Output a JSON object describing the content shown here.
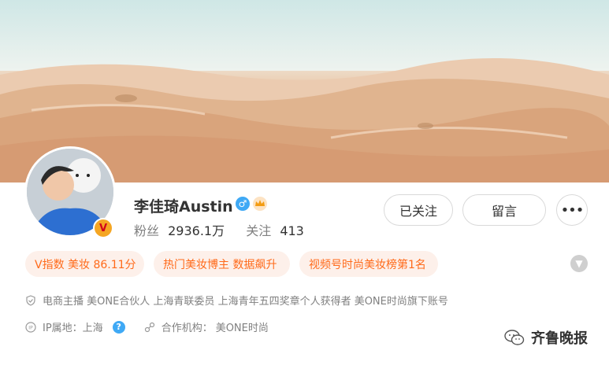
{
  "profile": {
    "name": "李佳琦Austin",
    "badge_letter": "V",
    "gender_icon": "male-icon",
    "vip_icon": "crown-icon",
    "followers_label": "粉丝",
    "followers_value": "2936.1万",
    "following_label": "关注",
    "following_value": "413"
  },
  "actions": {
    "follow_label": "已关注",
    "message_label": "留言",
    "more_label": "•••"
  },
  "tags": [
    {
      "label": "V指数 美妆 86.11分"
    },
    {
      "label": "热门美妆博主 数据飙升"
    },
    {
      "label": "视频号时尚美妆榜第1名"
    }
  ],
  "expand_icon": "chevron-down-icon",
  "info": {
    "description": "电商主播 美ONE合伙人 上海青联委员 上海青年五四奖章个人获得者 美ONE时尚旗下账号",
    "ip_label": "IP属地：上海",
    "org_label": "合作机构：",
    "org_value": "美ONE时尚"
  },
  "watermark": {
    "text": "齐鲁晚报"
  },
  "colors": {
    "tag_text": "#ff6a1a",
    "tag_bg": "#fdf0ea",
    "accent_blue": "#3fa9f5",
    "badge_orange": "#f5a623"
  }
}
